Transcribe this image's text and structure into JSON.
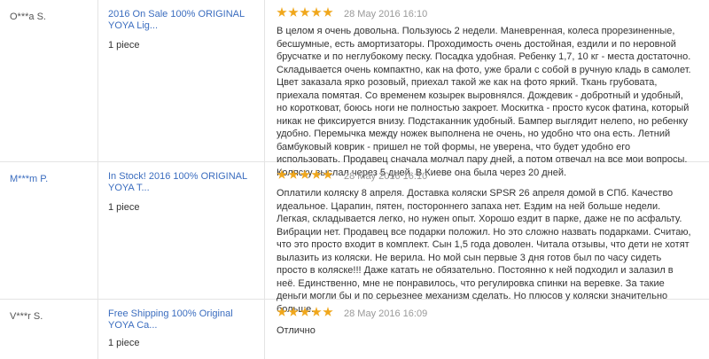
{
  "rating_color": "#f0a71c",
  "link_color": "#3b6dbf",
  "reviews": [
    {
      "buyer": "O***a S.",
      "product": "2016 On Sale 100% ORIGINAL YOYA Lig...",
      "quantity": "1 piece",
      "rating": 5,
      "date": "28 May 2016 16:10",
      "feedback": "В целом я очень довольна. Пользуюсь 2 недели. Маневренная, колеса прорезиненные, бесшумные, есть амортизаторы. Проходимость очень достойная, ездили и по неровной брусчатке и по неглубокому песку. Посадка удобная. Ребенку 1,7, 10 кг - места достаточно. Складывается очень компактно, как на фото, уже брали с собой в ручную кладь в самолет. Цвет заказала ярко розовый, приехал такой же как на фото яркий. Ткань грубовата, приехала помятая. Со временем козырек выровнялся. Дождевик - добротный и удобный, но коротковат, боюсь ноги не полностью закроет. Москитка - просто кусок фатина, который никак не фиксируется внизу. Подстаканник удобный. Бампер выглядит нелепо, но ребенку удобно. Перемычка между ножек выполнена не очень, но удобно что она есть. Летний бамбуковый коврик - пришел не той формы, не уверена, что будет удобно его использовать. Продавец сначала молчал пару дней, а потом отвечал на все мои вопросы. Коляску выслал через 5 дней. В Киеве она была через 20 дней."
    },
    {
      "buyer": "M***m P.",
      "product": "In Stock! 2016 100% ORIGINAL YOYA T...",
      "quantity": "1 piece",
      "rating": 5,
      "date": "28 May 2016 16:10",
      "feedback": "Оплатили коляску 8 апреля. Доставка коляски SPSR 26 апреля домой в СПб. Качество идеальное. Царапин, пятен, постороннего запаха нет. Ездим на ней больше недели. Легкая, складывается легко, но нужен опыт. Хорошо ездит в парке, даже не по асфальту. Вибрации нет. Продавец все подарки положил. Но это сложно назвать подарками. Считаю, что это просто входит в комплект. Сын 1,5 года доволен. Читала отзывы, что дети не хотят вылазить из коляски. Не верила. Но мой сын первые 3 дня готов был по часу сидеть просто в коляске!!! Даже катать не обязательно. Постоянно к ней подходил и залазил в неё. Единственно, мне не понравилось, что регулировка спинки на веревке. За такие деньги могли бы и по серьезнее механизм сделать. Но плюсов у коляски значительно больше."
    },
    {
      "buyer": "V***r S.",
      "product": "Free Shipping 100% Original YOYA Ca...",
      "quantity": "1 piece",
      "rating": 5,
      "date": "28 May 2016 16:09",
      "feedback": "Отлично"
    }
  ]
}
